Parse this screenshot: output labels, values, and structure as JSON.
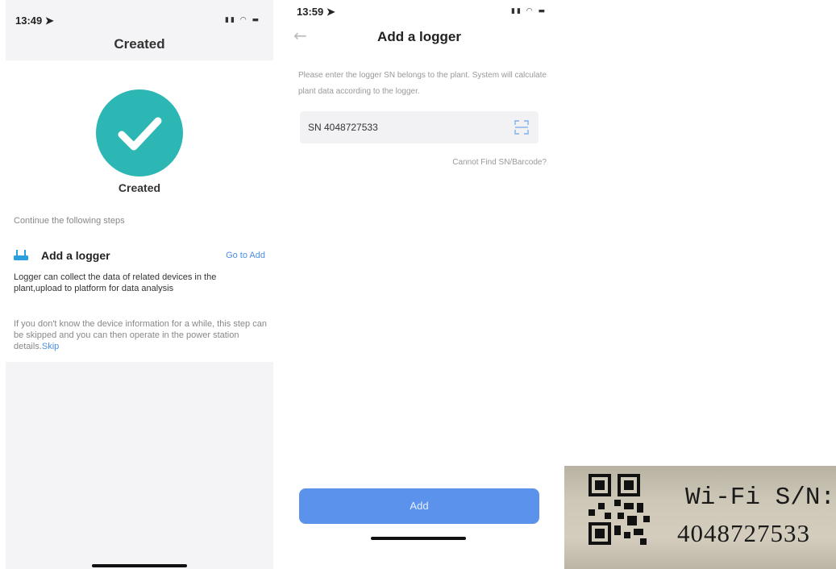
{
  "screen_created": {
    "time": "13:49",
    "title": "Created",
    "success_label": "Created",
    "continue_text": "Continue the following steps",
    "logger_step": {
      "title": "Add a logger",
      "action": "Go to Add",
      "description": "Logger can collect the data of related devices in the plant,upload to platform for data analysis"
    },
    "skip_note": "If you don't know the device information for a while, this step can be skipped and you can then operate in the power station details.",
    "skip_link": "Skip",
    "icons": [
      "success-check-icon",
      "logger-router-icon"
    ],
    "colors": {
      "success": "#2cb6b4",
      "link": "#4a8de8"
    }
  },
  "screen_add_logger": {
    "time": "13:59",
    "title": "Add a logger",
    "hint": "Please enter the logger SN belongs to the plant. System will calculate plant data according to the logger.",
    "sn_field_value": "SN 4048727533",
    "cannot_find": "Cannot Find SN/Barcode?",
    "add_button": "Add",
    "icons": [
      "back-arrow-icon",
      "scan-icon"
    ],
    "colors": {
      "button": "#5b93ec"
    }
  },
  "label_photo": {
    "line1": "Wi-Fi S/N:",
    "line2": "4048727533"
  }
}
